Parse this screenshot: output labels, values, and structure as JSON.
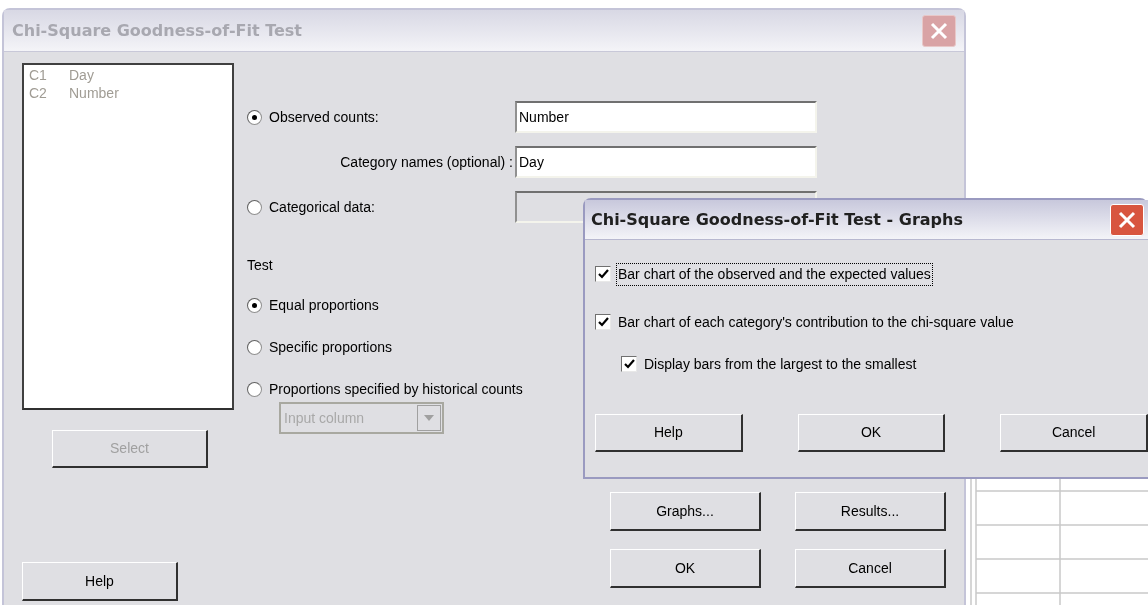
{
  "main_dialog": {
    "title": "Chi-Square Goodness-of-Fit Test",
    "active": false,
    "variables": [
      {
        "column": "C1",
        "name": "Day"
      },
      {
        "column": "C2",
        "name": "Number"
      }
    ],
    "select_button": {
      "label": "Select",
      "disabled": true
    },
    "data_options": [
      {
        "label": "Observed counts:",
        "selected": true,
        "value": "Number"
      },
      {
        "label": "Categorical data:",
        "selected": false
      }
    ],
    "category_names": {
      "label": "Category names (optional) :",
      "value": "Day"
    },
    "test": {
      "label": "Test",
      "options": [
        {
          "label": "Equal proportions",
          "selected": true
        },
        {
          "label": "Specific proportions",
          "selected": false
        },
        {
          "label": "Proportions specified by historical counts",
          "selected": false
        }
      ]
    },
    "historical_dropdown": {
      "value": "Input column",
      "disabled": true
    },
    "help_button": "Help",
    "buttons": [
      "Graphs...",
      "Results...",
      "OK",
      "Cancel"
    ]
  },
  "graphs_dialog": {
    "title": "Chi-Square Goodness-of-Fit Test - Graphs",
    "active": true,
    "options": [
      {
        "label": "Bar chart of the observed and the expected values",
        "checked": true,
        "focused": true
      },
      {
        "label": "Bar chart of each category's contribution to the chi-square value",
        "checked": true,
        "focused": false,
        "children": [
          {
            "label": "Display bars from the largest to the smallest",
            "checked": true,
            "focused": false
          }
        ]
      }
    ],
    "buttons": [
      "Help",
      "OK",
      "Cancel"
    ]
  }
}
